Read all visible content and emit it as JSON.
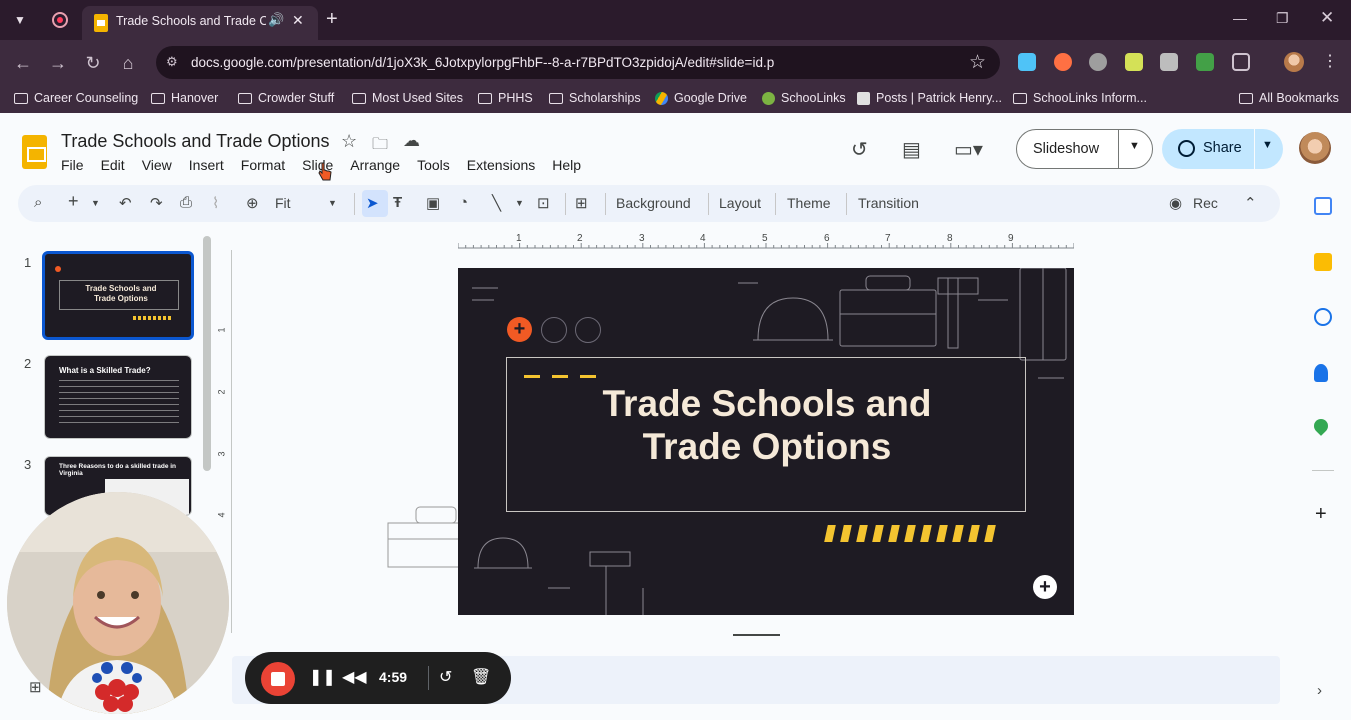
{
  "browser": {
    "tab_title": "Trade Schools and Trade Options",
    "url": "docs.google.com/presentation/d/1joX3k_6JotxpylorpgFhbF--8-a-r7BPdTO3zpidojA/edit#slide=id.p",
    "bookmarks": [
      {
        "label": "Career Counseling",
        "icon": "folder-icon"
      },
      {
        "label": "Hanover",
        "icon": "folder-icon"
      },
      {
        "label": "Crowder Stuff",
        "icon": "folder-icon"
      },
      {
        "label": "Most Used Sites",
        "icon": "folder-icon"
      },
      {
        "label": "PHHS",
        "icon": "folder-icon"
      },
      {
        "label": "Scholarships",
        "icon": "folder-icon"
      },
      {
        "label": "Google Drive",
        "icon": "google-drive-icon"
      },
      {
        "label": "SchooLinks",
        "icon": "schoolinks-icon"
      },
      {
        "label": "Posts | Patrick Henry...",
        "icon": "posts-icon"
      },
      {
        "label": "SchooLinks Inform...",
        "icon": "folder-icon"
      }
    ],
    "all_bookmarks": "All Bookmarks"
  },
  "doc": {
    "title": "Trade Schools and Trade Options",
    "menu": [
      "File",
      "Edit",
      "View",
      "Insert",
      "Format",
      "Slide",
      "Arrange",
      "Tools",
      "Extensions",
      "Help"
    ],
    "slideshow_label": "Slideshow",
    "share_label": "Share"
  },
  "toolbar": {
    "zoom": "Fit",
    "background": "Background",
    "layout": "Layout",
    "theme": "Theme",
    "transition": "Transition",
    "rec": "Rec"
  },
  "ruler": [
    "1",
    "2",
    "3",
    "4",
    "5",
    "6",
    "7",
    "8",
    "9"
  ],
  "ruler_v": [
    "1",
    "2",
    "3",
    "4"
  ],
  "slides": [
    {
      "num": "1",
      "title": "Trade Schools and Trade Options"
    },
    {
      "num": "2",
      "title": "What is a Skilled Trade?"
    },
    {
      "num": "3",
      "title": "Three Reasons to do a skilled trade in Virginia"
    }
  ],
  "slide": {
    "title_line1": "Trade Schools and",
    "title_line2": "Trade Options"
  },
  "recorder": {
    "time": "4:59"
  },
  "colors": {
    "accent_orange": "#f15a24",
    "stripe_yellow": "#f4c430",
    "slide_bg": "#1e1b23",
    "share_bg": "#c2e7ff",
    "rec_red": "#ea4335"
  }
}
